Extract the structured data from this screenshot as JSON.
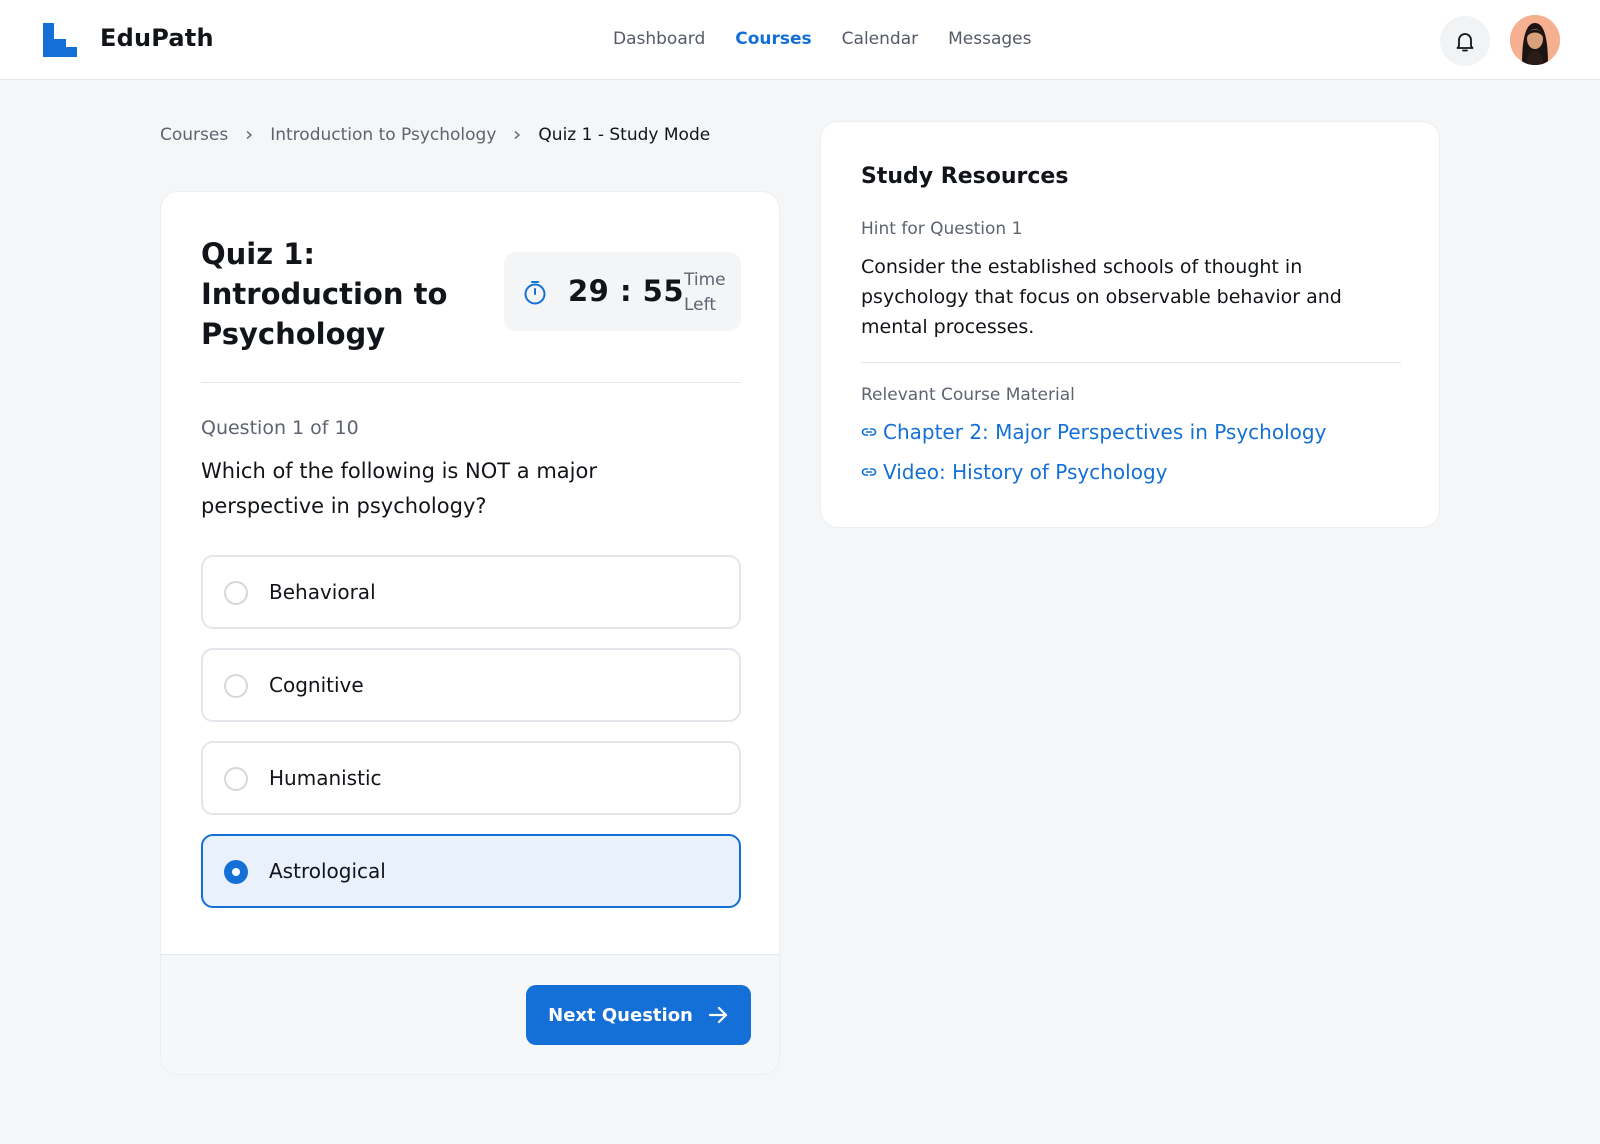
{
  "app": {
    "brand": "EduPath"
  },
  "nav": {
    "items": [
      {
        "label": "Dashboard",
        "active": false
      },
      {
        "label": "Courses",
        "active": true
      },
      {
        "label": "Calendar",
        "active": false
      },
      {
        "label": "Messages",
        "active": false
      }
    ]
  },
  "header": {
    "notification_icon": "bell-icon",
    "avatar": "user-avatar"
  },
  "breadcrumb": {
    "items": [
      "Courses",
      "Introduction to Psychology"
    ],
    "current": "Quiz 1 - Study Mode"
  },
  "quiz": {
    "title": "Quiz 1: Introduction to Psychology",
    "timer": {
      "value": "29 : 55",
      "label": "Time Left",
      "icon": "stopwatch-icon"
    },
    "question_count": "Question 1 of 10",
    "question": "Which of the following is NOT a major perspective in psychology?",
    "options": [
      {
        "label": "Behavioral",
        "selected": false
      },
      {
        "label": "Cognitive",
        "selected": false
      },
      {
        "label": "Humanistic",
        "selected": false
      },
      {
        "label": "Astrological",
        "selected": true
      }
    ],
    "next_button": "Next Question"
  },
  "resources": {
    "title": "Study Resources",
    "hint_label": "Hint for Question 1",
    "hint_text": "Consider the established schools of thought in psychology that focus on observable behavior and mental processes.",
    "material_label": "Relevant Course Material",
    "links": [
      {
        "label": "Chapter 2: Major Perspectives in Psychology"
      },
      {
        "label": "Video: History of Psychology"
      }
    ]
  },
  "colors": {
    "accent": "#1470d6",
    "background": "#f5f6f8",
    "selected_bg": "#e8f1fc"
  }
}
